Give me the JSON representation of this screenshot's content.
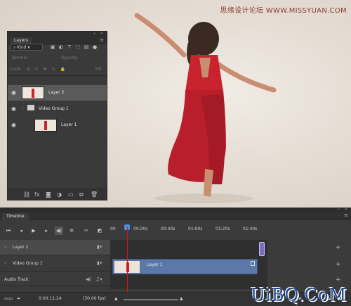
{
  "watermark": "思缘设计论坛 WWW.MISSYUAN.COM",
  "layers_panel": {
    "tab": "Layers",
    "filter_kind": "Kind",
    "blend_mode": "Normal",
    "opacity_label": "Opacity:",
    "lock_label": "Lock:",
    "fill_label": "Fill:",
    "layers": [
      {
        "name": "Layer 2"
      },
      {
        "name": "Video Group 1"
      },
      {
        "name": "Layer 1"
      }
    ]
  },
  "timeline": {
    "tab": "Timeline",
    "ruler": [
      "00",
      "00:20s",
      "00:40s",
      "01:00s",
      "01:20s",
      "01:40s"
    ],
    "tracks": [
      {
        "label": "Layer 2"
      },
      {
        "label": "Video Group 1"
      },
      {
        "label": "Audio Track"
      }
    ],
    "clip_label": "Layer 1",
    "current_time": "0:00:11:24",
    "fps": "(30.00 fps)"
  },
  "brand": "UiBQ.CoM",
  "colors": {
    "dress": "#c8232f",
    "clip": "#5b78a8",
    "playhead": "#dd1111",
    "brand": "#1f4fa0"
  }
}
